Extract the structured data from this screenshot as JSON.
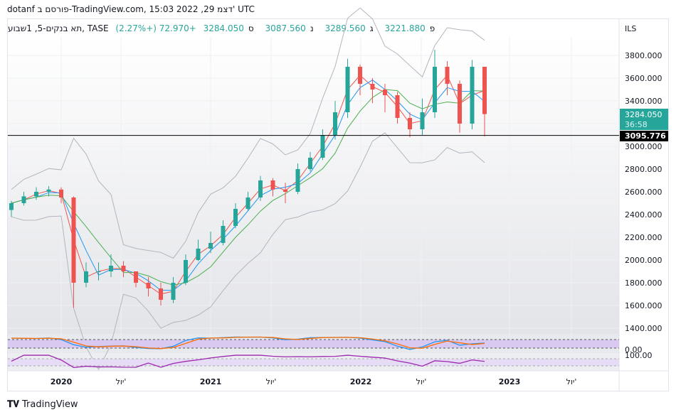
{
  "header": {
    "text": "dotanf פורסם ב-TradingView.com, 15:03 2022 ,29 דצמ' UTC"
  },
  "legend": {
    "symbol": "תא בנקים-5, 1שבוע, TASE",
    "open_label": "פ",
    "open": "3221.880",
    "high_label": "ג",
    "high": "3289.560",
    "low_label": "נ",
    "low": "3087.560",
    "close_label": "ס",
    "close": "3284.050",
    "change": "+72.970 (+2.27%)"
  },
  "price_axis": {
    "currency": "ILS",
    "ticks": [
      "3800.000",
      "3600.000",
      "3400.000",
      "3200.000",
      "3000.000",
      "2800.000",
      "2600.000",
      "2400.000",
      "2200.000",
      "2000.000",
      "1800.000",
      "1600.000",
      "1400.000"
    ],
    "last_price": "3284.050",
    "countdown": "36:58",
    "hline": "3095.776"
  },
  "pane_labels": {
    "stoch_low": "0.00",
    "rsi_high": "100.00"
  },
  "time_axis": [
    "2020",
    "יול'",
    "2021",
    "יול'",
    "2022",
    "יול'",
    "2023",
    "יול'"
  ],
  "footer": {
    "brand": "TradingView"
  },
  "colors": {
    "up": "#26a69a",
    "down": "#ef5350",
    "ma_fast": "#ef5350",
    "ma_mid": "#2196f3",
    "ma_slow": "#4caf50",
    "band": "#b2b5be",
    "stoch_k": "#2196f3",
    "stoch_d": "#ff6d00",
    "rsi": "#9c27b0",
    "last_bg": "#26a69a"
  },
  "chart_data": {
    "type": "candlestick",
    "ylim": [
      1400,
      3850
    ],
    "hline": 3095.776,
    "x": [
      "2019-10",
      "2019-11",
      "2019-12",
      "2020-01",
      "2020-02",
      "2020-03",
      "2020-04",
      "2020-05",
      "2020-06",
      "2020-07",
      "2020-08",
      "2020-09",
      "2020-10",
      "2020-11",
      "2020-12",
      "2021-01",
      "2021-02",
      "2021-03",
      "2021-04",
      "2021-05",
      "2021-06",
      "2021-07",
      "2021-08",
      "2021-09",
      "2021-10",
      "2021-11",
      "2021-12",
      "2022-01",
      "2022-02",
      "2022-03",
      "2022-04",
      "2022-05",
      "2022-06",
      "2022-07",
      "2022-08",
      "2022-09",
      "2022-10",
      "2022-11",
      "2022-12"
    ],
    "close": [
      2500,
      2560,
      2600,
      2620,
      2550,
      1800,
      1900,
      1900,
      1950,
      1900,
      1800,
      1750,
      1650,
      1800,
      2000,
      2100,
      2150,
      2300,
      2450,
      2550,
      2700,
      2620,
      2600,
      2800,
      2900,
      3100,
      3300,
      3700,
      3550,
      3500,
      3450,
      3250,
      3150,
      3300,
      3700,
      3550,
      3200,
      3700,
      3284
    ],
    "high": [
      2520,
      2600,
      2640,
      2650,
      2640,
      2560,
      1980,
      1980,
      2050,
      1990,
      1900,
      1850,
      1800,
      1850,
      2050,
      2180,
      2250,
      2350,
      2500,
      2600,
      2740,
      2720,
      2680,
      2850,
      2950,
      3150,
      3400,
      3770,
      3720,
      3600,
      3550,
      3480,
      3300,
      3420,
      3850,
      3750,
      3580,
      3760,
      3400
    ],
    "low": [
      2380,
      2480,
      2530,
      2560,
      2500,
      1580,
      1760,
      1820,
      1850,
      1850,
      1760,
      1680,
      1600,
      1620,
      1780,
      1990,
      2060,
      2130,
      2280,
      2430,
      2520,
      2560,
      2500,
      2580,
      2780,
      2880,
      3060,
      3250,
      3450,
      3380,
      3300,
      3200,
      3080,
      3100,
      3250,
      3450,
      3120,
      3150,
      3087
    ]
  }
}
